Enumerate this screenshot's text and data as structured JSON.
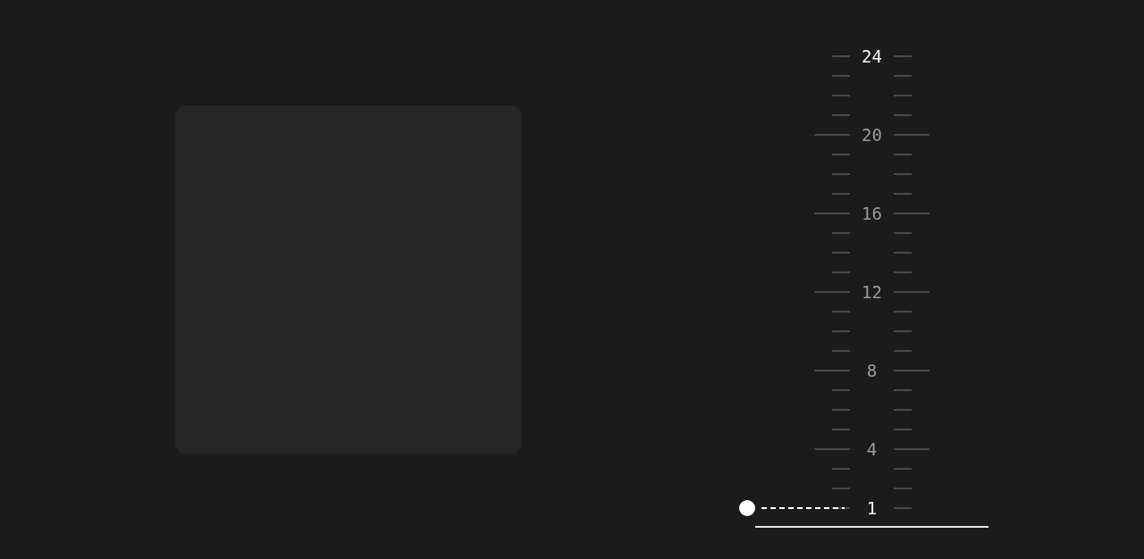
{
  "scale": {
    "rows": [
      {
        "label": "24",
        "major": false,
        "highlighted": true,
        "selected": false
      },
      {
        "major": false,
        "selected": false
      },
      {
        "major": false,
        "selected": false
      },
      {
        "major": false,
        "selected": false
      },
      {
        "label": "20",
        "major": true,
        "highlighted": false,
        "selected": false
      },
      {
        "major": false,
        "selected": false
      },
      {
        "major": false,
        "selected": false
      },
      {
        "major": false,
        "selected": false
      },
      {
        "label": "16",
        "major": true,
        "highlighted": false,
        "selected": false
      },
      {
        "major": false,
        "selected": false
      },
      {
        "major": false,
        "selected": false
      },
      {
        "major": false,
        "selected": false
      },
      {
        "label": "12",
        "major": true,
        "highlighted": false,
        "selected": false
      },
      {
        "major": false,
        "selected": false
      },
      {
        "major": false,
        "selected": false
      },
      {
        "major": false,
        "selected": false
      },
      {
        "label": "8",
        "major": true,
        "highlighted": false,
        "selected": false
      },
      {
        "major": false,
        "selected": false
      },
      {
        "major": false,
        "selected": false
      },
      {
        "major": false,
        "selected": false
      },
      {
        "label": "4",
        "major": true,
        "highlighted": false,
        "selected": false
      },
      {
        "major": false,
        "selected": false
      },
      {
        "major": false,
        "selected": false
      },
      {
        "label": "1",
        "major": false,
        "highlighted": true,
        "selected": true
      }
    ]
  }
}
